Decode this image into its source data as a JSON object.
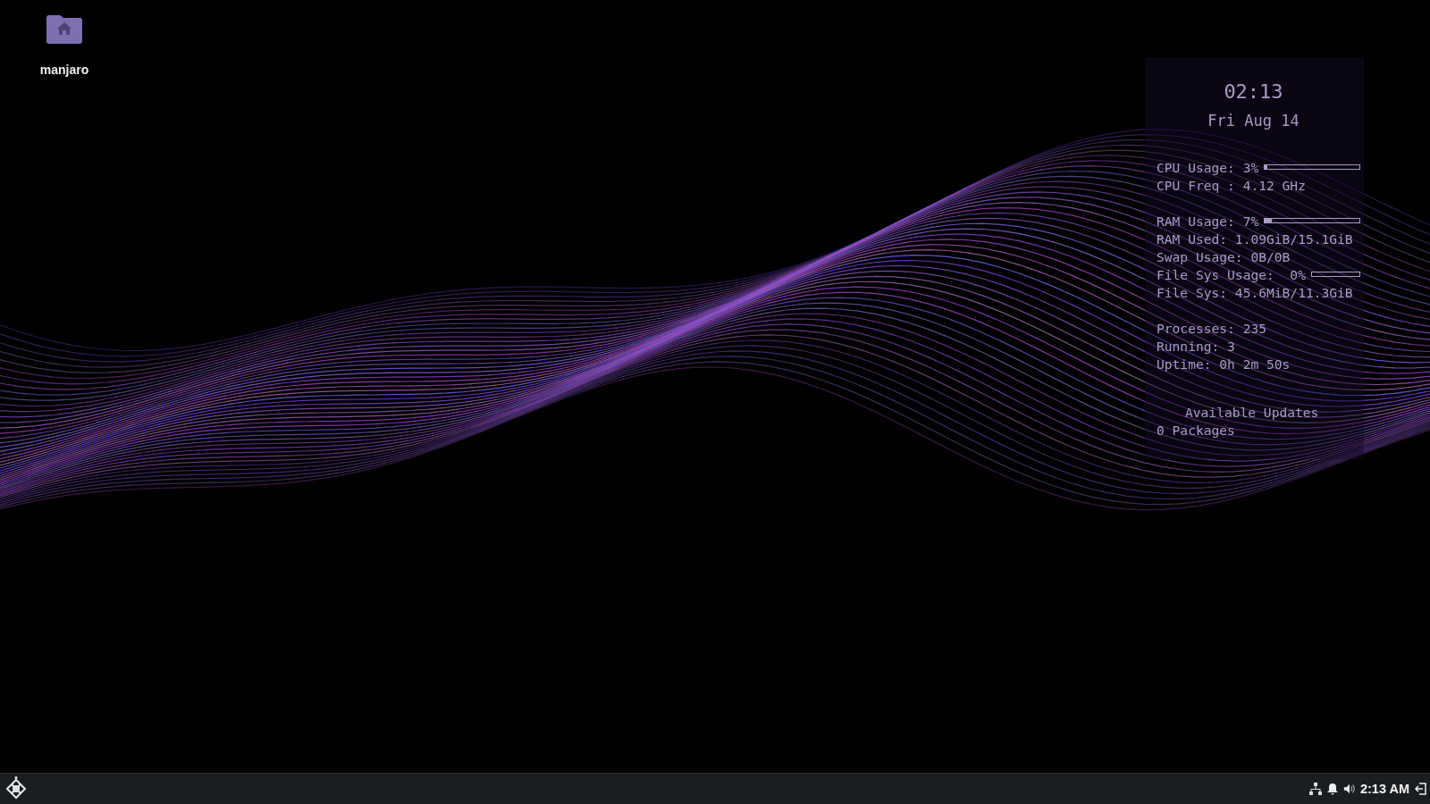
{
  "desktop": {
    "icons": [
      {
        "label": "manjaro"
      }
    ]
  },
  "conky": {
    "clock": "02:13",
    "date": "Fri Aug 14",
    "sections": [
      [
        {
          "kind": "meter",
          "text": "CPU Usage: 3%",
          "level": 0.03
        },
        {
          "kind": "text",
          "text": "CPU Freq : 4.12 GHz"
        }
      ],
      [
        {
          "kind": "meter",
          "text": "RAM Usage: 7%",
          "level": 0.07
        },
        {
          "kind": "text",
          "text": "RAM Used: 1.09GiB/15.1GiB"
        },
        {
          "kind": "text",
          "text": "Swap Usage: 0B/0B"
        },
        {
          "kind": "meter",
          "text": "File Sys Usage:  0%",
          "level": 0
        },
        {
          "kind": "text",
          "text": "File Sys: 45.6MiB/11.3GiB"
        }
      ],
      [
        {
          "kind": "text",
          "text": "Processes: 235"
        },
        {
          "kind": "text",
          "text": "Running: 3"
        },
        {
          "kind": "text",
          "text": "Uptime: 0h 2m 50s"
        }
      ]
    ],
    "updates": {
      "title": "Available Updates",
      "count": "0 Packages"
    }
  },
  "taskbar": {
    "clock": "2:13 AM"
  }
}
